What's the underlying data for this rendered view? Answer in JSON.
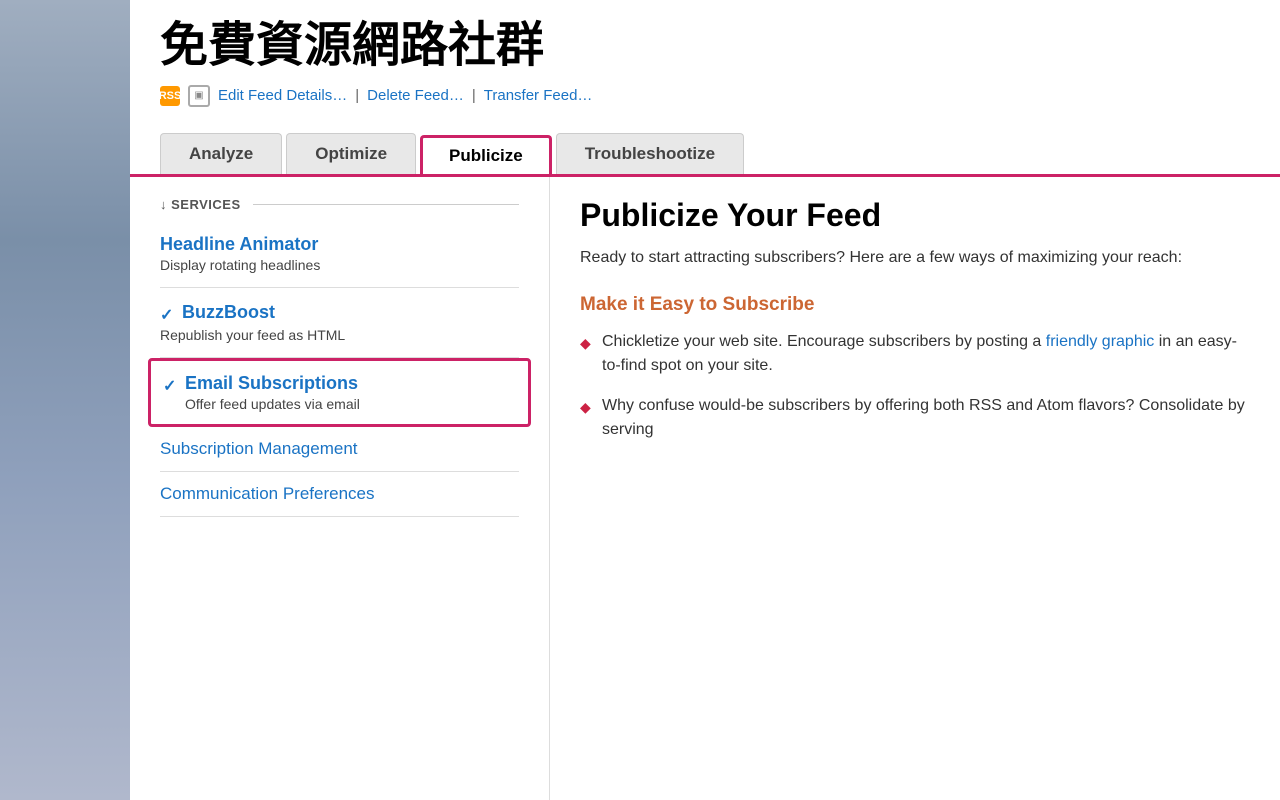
{
  "sidebar": {
    "background": "gradient-blue-grey"
  },
  "header": {
    "title": "免費資源網路社群",
    "links": {
      "edit": "Edit Feed Details…",
      "delete": "Delete Feed…",
      "transfer": "Transfer Feed…"
    }
  },
  "tabs": [
    {
      "id": "analyze",
      "label": "Analyze",
      "active": false
    },
    {
      "id": "optimize",
      "label": "Optimize",
      "active": false
    },
    {
      "id": "publicize",
      "label": "Publicize",
      "active": true
    },
    {
      "id": "troubleshootize",
      "label": "Troubleshootize",
      "active": false
    }
  ],
  "services": {
    "header": "↓ SERVICES",
    "items": [
      {
        "id": "headline-animator",
        "name": "Headline Animator",
        "description": "Display rotating headlines",
        "checked": false,
        "highlighted": false
      },
      {
        "id": "buzzboost",
        "name": "BuzzBoost",
        "description": "Republish your feed as HTML",
        "checked": true,
        "highlighted": false
      },
      {
        "id": "email-subscriptions",
        "name": "Email Subscriptions",
        "description": "Offer feed updates via email",
        "checked": true,
        "highlighted": true
      }
    ],
    "links": [
      {
        "id": "subscription-management",
        "label": "Subscription Management"
      },
      {
        "id": "communication-preferences",
        "label": "Communication Preferences"
      }
    ]
  },
  "publicize": {
    "title": "Publicize Your Feed",
    "intro": "Ready to start attracting subscribers? Here are a few ways of maximizing your reach:",
    "section_heading": "Make it Easy to Subscribe",
    "bullets": [
      {
        "text_before": "Chickletize your web site. Encourage subscribers by posting a ",
        "link_text": "friendly graphic",
        "text_after": " in an easy-to-find spot on your site."
      },
      {
        "text_before": "Why confuse would-be subscribers by offering both RSS and Atom flavors? Consolidate by serving",
        "link_text": "",
        "text_after": ""
      }
    ]
  }
}
